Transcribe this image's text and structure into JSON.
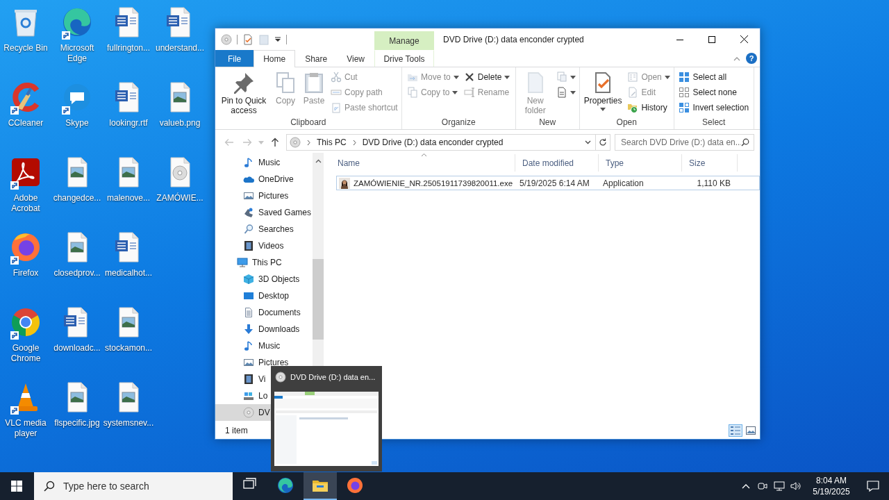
{
  "desktop": {
    "columns": [
      [
        {
          "label": "Recycle Bin",
          "kind": "recycle",
          "shortcut": false
        },
        {
          "label": "CCleaner",
          "kind": "ccleaner",
          "shortcut": true
        },
        {
          "label": "Adobe Acrobat",
          "kind": "acrobat",
          "shortcut": true
        },
        {
          "label": "Firefox",
          "kind": "firefox",
          "shortcut": true
        },
        {
          "label": "Google Chrome",
          "kind": "chrome",
          "shortcut": true
        },
        {
          "label": "VLC media player",
          "kind": "vlc",
          "shortcut": true
        }
      ],
      [
        {
          "label": "Microsoft Edge",
          "kind": "edge",
          "shortcut": true
        },
        {
          "label": "Skype",
          "kind": "skype",
          "shortcut": true
        },
        {
          "label": "changedce...",
          "kind": "image",
          "shortcut": false
        },
        {
          "label": "closedprov...",
          "kind": "image",
          "shortcut": false
        },
        {
          "label": "downloadc...",
          "kind": "word",
          "shortcut": false
        },
        {
          "label": "flspecific.jpg",
          "kind": "image",
          "shortcut": false
        }
      ],
      [
        {
          "label": "fullrington...",
          "kind": "word",
          "shortcut": false
        },
        {
          "label": "lookingr.rtf",
          "kind": "word",
          "shortcut": false
        },
        {
          "label": "malenove...",
          "kind": "image",
          "shortcut": false
        },
        {
          "label": "medicalhot...",
          "kind": "word",
          "shortcut": false
        },
        {
          "label": "stockamon...",
          "kind": "image",
          "shortcut": false
        },
        {
          "label": "systemsnev...",
          "kind": "image",
          "shortcut": false
        }
      ],
      [
        {
          "label": "understand...",
          "kind": "word",
          "shortcut": false
        },
        {
          "label": "valueb.png",
          "kind": "image",
          "shortcut": false
        },
        {
          "label": "ZAMÓWIE...",
          "kind": "disc",
          "shortcut": false
        }
      ]
    ]
  },
  "explorer": {
    "context_tab_label": "Manage",
    "title": "DVD Drive (D:) data enconder crypted",
    "tabs": [
      {
        "label": "File",
        "kind": "file",
        "selected": false
      },
      {
        "label": "Home",
        "kind": "normal",
        "selected": true
      },
      {
        "label": "Share",
        "kind": "normal",
        "selected": false
      },
      {
        "label": "View",
        "kind": "normal",
        "selected": false
      },
      {
        "label": "Drive Tools",
        "kind": "contextual",
        "selected": false
      }
    ],
    "help_label": "?",
    "ribbon": {
      "groups": [
        {
          "label": "Clipboard",
          "columns": [
            [
              {
                "label": "Pin to Quick access",
                "kind": "pin",
                "disabled": false,
                "dropdown": false
              }
            ],
            [
              {
                "label": "Copy",
                "kind": "copy",
                "disabled": true,
                "dropdown": false
              }
            ],
            [
              {
                "label": "Paste",
                "kind": "paste",
                "disabled": true,
                "dropdown": false
              }
            ],
            [
              {
                "label": "Cut",
                "kind": "cut",
                "disabled": true,
                "dropdown": false
              },
              {
                "label": "Copy path",
                "kind": "copypath",
                "disabled": true,
                "dropdown": false
              },
              {
                "label": "Paste shortcut",
                "kind": "pasteshortcut",
                "disabled": true,
                "dropdown": false
              }
            ]
          ]
        },
        {
          "label": "Organize",
          "columns": [
            [
              {
                "label": "Move to",
                "kind": "move",
                "disabled": true,
                "dropdown": true
              },
              {
                "label": "Copy to",
                "kind": "copyto",
                "disabled": true,
                "dropdown": true
              }
            ],
            [
              {
                "label": "Delete",
                "kind": "delete",
                "disabled": false,
                "dropdown": true
              },
              {
                "label": "Rename",
                "kind": "rename",
                "disabled": true,
                "dropdown": false
              }
            ]
          ]
        },
        {
          "label": "New",
          "columns": [
            [
              {
                "label": "New folder",
                "kind": "newfolder",
                "disabled": true,
                "dropdown": false
              }
            ],
            [
              {
                "kind": "newitem",
                "disabled": true,
                "dropdown": true
              },
              {
                "kind": "easyaccess",
                "disabled": false,
                "dropdown": true
              }
            ]
          ]
        },
        {
          "label": "Open",
          "columns": [
            [
              {
                "label": "Properties",
                "kind": "properties",
                "disabled": false,
                "dropdown": true
              }
            ],
            [
              {
                "label": "Open",
                "kind": "open",
                "disabled": true,
                "dropdown": true
              },
              {
                "label": "Edit",
                "kind": "edit",
                "disabled": true,
                "dropdown": false
              },
              {
                "label": "History",
                "kind": "history",
                "disabled": false,
                "dropdown": false
              }
            ]
          ]
        },
        {
          "label": "Select",
          "columns": [
            [
              {
                "label": "Select all",
                "kind": "selectall",
                "disabled": false,
                "dropdown": false
              },
              {
                "label": "Select none",
                "kind": "selectnone",
                "disabled": false,
                "dropdown": false
              },
              {
                "label": "Invert selection",
                "kind": "invert",
                "disabled": false,
                "dropdown": false
              }
            ]
          ]
        }
      ]
    },
    "address_bar": {
      "segments": [
        "This PC",
        "DVD Drive (D:) data enconder crypted"
      ]
    },
    "search": {
      "placeholder": "Search DVD Drive (D:) data en..."
    },
    "nav_pane": {
      "items": [
        {
          "children": [
            {
              "label": "Music",
              "kind": "music",
              "selected": false
            },
            {
              "label": "OneDrive",
              "kind": "onedrive",
              "selected": false
            },
            {
              "label": "Pictures",
              "kind": "pictures",
              "selected": false
            },
            {
              "label": "Saved Games",
              "kind": "games",
              "selected": false
            },
            {
              "label": "Searches",
              "kind": "searches",
              "selected": false
            },
            {
              "label": "Videos",
              "kind": "videos",
              "selected": false
            }
          ]
        },
        {
          "label": "This PC",
          "kind": "pc",
          "selected": false,
          "children": [
            {
              "label": "3D Objects",
              "kind": "objects3d",
              "selected": false
            },
            {
              "label": "Desktop",
              "kind": "desktop",
              "selected": false
            },
            {
              "label": "Documents",
              "kind": "documents",
              "selected": false
            },
            {
              "label": "Downloads",
              "kind": "downloads",
              "selected": false
            },
            {
              "label": "Music",
              "kind": "music",
              "selected": false
            },
            {
              "label": "Pictures",
              "kind": "pictures",
              "selected": false
            },
            {
              "label": "Vi",
              "kind": "videos",
              "selected": false
            },
            {
              "label": "Lo",
              "kind": "disk",
              "selected": false
            },
            {
              "label": "DV",
              "kind": "dvd",
              "selected": true
            }
          ]
        }
      ]
    },
    "file_list": {
      "columns": [
        {
          "label": "Name",
          "sorted": true
        },
        {
          "label": "Date modified",
          "sorted": false
        },
        {
          "label": "Type",
          "sorted": false
        },
        {
          "label": "Size",
          "sorted": false
        }
      ],
      "rows": [
        {
          "cells": [
            "ZAMÓWIENIE_NR.25051911739820011.exe",
            "5/19/2025 6:14 AM",
            "Application",
            "1,110 KB"
          ],
          "focused": true,
          "selected": false
        }
      ]
    },
    "status_bar": {
      "text": "1 item",
      "views": [
        {
          "kind": "details",
          "selected": true
        },
        {
          "kind": "large_icons",
          "selected": false
        }
      ]
    }
  },
  "thumbnail": {
    "title": "DVD Drive (D:) data en..."
  },
  "taskbar": {
    "search": {
      "placeholder": "Type here to search"
    },
    "apps": [
      {
        "kind": "task_view",
        "active": false
      },
      {
        "kind": "edge",
        "active": false
      },
      {
        "kind": "explorer",
        "active": true
      },
      {
        "kind": "firefox",
        "active": false
      }
    ],
    "clock": {
      "time": "8:04 AM",
      "date": "5/19/2025"
    }
  }
}
